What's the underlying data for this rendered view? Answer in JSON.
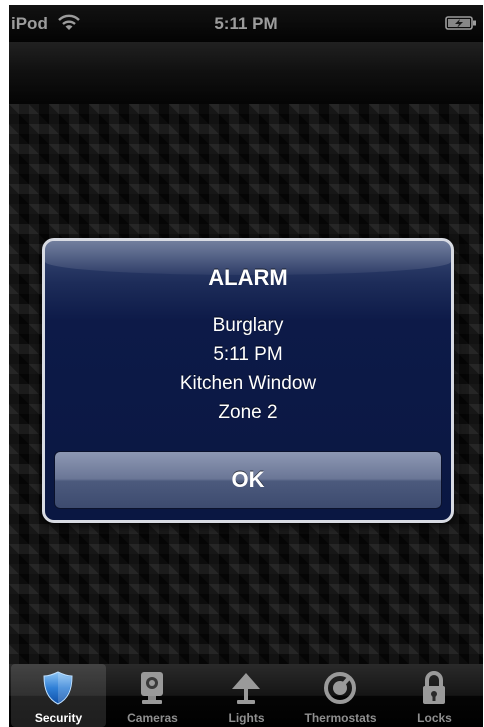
{
  "status_bar": {
    "carrier": "iPod",
    "time": "5:11 PM",
    "wifi_icon": "wifi-icon",
    "battery_icon": "battery-charging-icon"
  },
  "alert": {
    "title": "ALARM",
    "lines": [
      "Burglary",
      "5:11 PM",
      "Kitchen Window",
      "Zone 2"
    ],
    "ok_label": "OK"
  },
  "tabs": [
    {
      "label": "Security",
      "icon": "shield-icon",
      "selected": true
    },
    {
      "label": "Cameras",
      "icon": "camera-icon",
      "selected": false
    },
    {
      "label": "Lights",
      "icon": "lamp-icon",
      "selected": false
    },
    {
      "label": "Thermostats",
      "icon": "thermostat-dial-icon",
      "selected": false
    },
    {
      "label": "Locks",
      "icon": "lock-icon",
      "selected": false
    }
  ],
  "colors": {
    "alert_background": "#0d1a48",
    "tab_selected_accent": "#2f7fd6",
    "tab_inactive": "#8f8f8f"
  }
}
